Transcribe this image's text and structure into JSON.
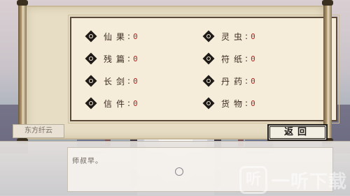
{
  "inventory": {
    "left_column": [
      {
        "label": "仙果",
        "value": "0"
      },
      {
        "label": "残篇",
        "value": "0"
      },
      {
        "label": "长剑",
        "value": "0"
      },
      {
        "label": "信件",
        "value": "0"
      }
    ],
    "right_column": [
      {
        "label": "灵虫",
        "value": "0"
      },
      {
        "label": "符纸",
        "value": "0"
      },
      {
        "label": "丹药",
        "value": "0"
      },
      {
        "label": "货物",
        "value": "0"
      }
    ]
  },
  "speaker_name": "东方纤云",
  "return_button_label": "返回",
  "dialog_text": "师叔早。",
  "watermark": {
    "badge": "听",
    "text": "一听下载"
  },
  "colors": {
    "value_red": "#b02222",
    "paper": "#f6ecda",
    "frame": "#5b4a3a"
  },
  "icons": {
    "item_marker": "diamond-bullet-icon"
  }
}
